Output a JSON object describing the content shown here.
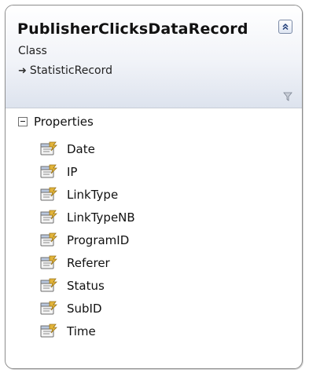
{
  "class_box": {
    "name": "PublisherClicksDataRecord",
    "stereotype": "Class",
    "base_class": "StatisticRecord",
    "collapse_icon": "double-chevron-up-icon",
    "filter_icon": "funnel-icon"
  },
  "properties_section": {
    "label": "Properties",
    "toggle_icon": "minus-box-icon",
    "item_icon": "property-icon",
    "items": [
      {
        "label": "Date"
      },
      {
        "label": "IP"
      },
      {
        "label": "LinkType"
      },
      {
        "label": "LinkTypeNB"
      },
      {
        "label": "ProgramID"
      },
      {
        "label": "Referer"
      },
      {
        "label": "Status"
      },
      {
        "label": "SubID"
      },
      {
        "label": "Time"
      }
    ]
  }
}
